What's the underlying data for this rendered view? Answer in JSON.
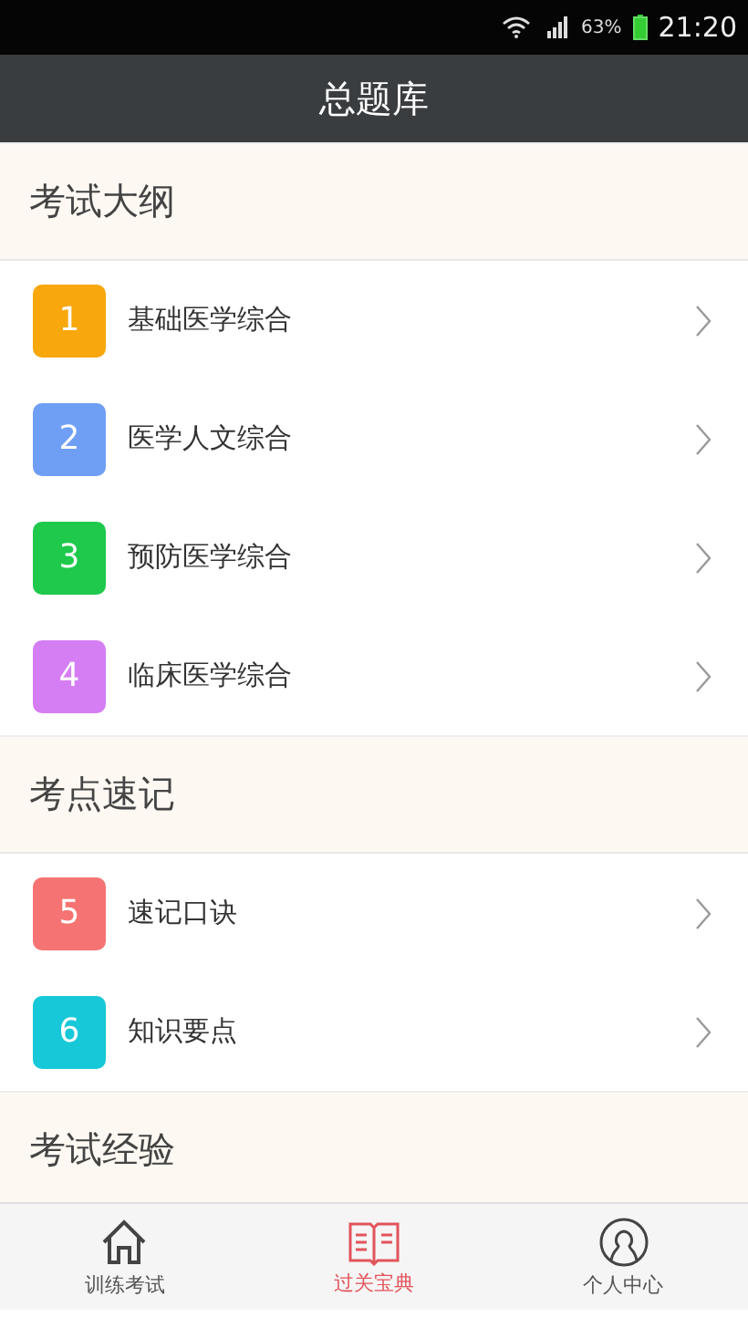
{
  "status_bar": {
    "battery": "63%",
    "time": "21:20"
  },
  "header": {
    "title": "总题库"
  },
  "sections": [
    {
      "title": "考试大纲",
      "items": [
        {
          "number": "1",
          "label": "基础医学综合",
          "color": "#f8a70c"
        },
        {
          "number": "2",
          "label": "医学人文综合",
          "color": "#6f9ff5"
        },
        {
          "number": "3",
          "label": "预防医学综合",
          "color": "#1ec94c"
        },
        {
          "number": "4",
          "label": "临床医学综合",
          "color": "#d57ef4"
        }
      ]
    },
    {
      "title": "考点速记",
      "items": [
        {
          "number": "5",
          "label": "速记口诀",
          "color": "#f57473"
        },
        {
          "number": "6",
          "label": "知识要点",
          "color": "#17c8d8"
        }
      ]
    },
    {
      "title": "考试经验"
    }
  ],
  "tabs": [
    {
      "kind": "home",
      "label": "训练考试",
      "selected": false
    },
    {
      "kind": "book",
      "label": "过关宝典",
      "selected": true
    },
    {
      "kind": "person",
      "label": "个人中心",
      "selected": false
    }
  ]
}
